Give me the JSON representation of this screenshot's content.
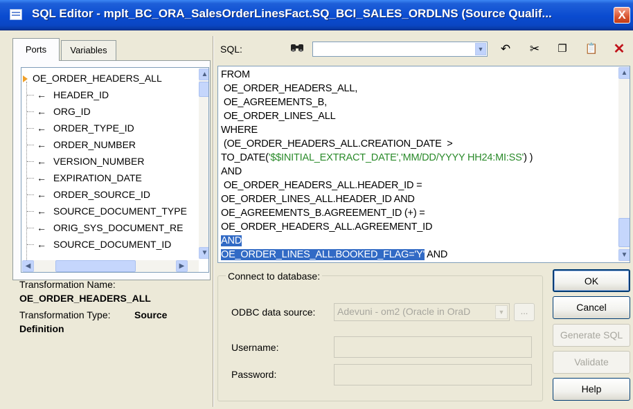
{
  "window": {
    "title": "SQL Editor - mplt_BC_ORA_SalesOrderLinesFact.SQ_BCI_SALES_ORDLNS (Source Qualif...",
    "close_label": "X"
  },
  "tabs": [
    {
      "label": "Ports"
    },
    {
      "label": "Variables"
    }
  ],
  "ports_tree": {
    "root": "OE_ORDER_HEADERS_ALL",
    "items": [
      "HEADER_ID",
      "ORG_ID",
      "ORDER_TYPE_ID",
      "ORDER_NUMBER",
      "VERSION_NUMBER",
      "EXPIRATION_DATE",
      "ORDER_SOURCE_ID",
      "SOURCE_DOCUMENT_TYPE",
      "ORIG_SYS_DOCUMENT_RE",
      "SOURCE_DOCUMENT_ID"
    ]
  },
  "transformation": {
    "name_label": "Transformation Name:",
    "name_value": "OE_ORDER_HEADERS_ALL",
    "type_label": "Transformation Type:",
    "type_value": "Source",
    "type_value_line2": "Definition"
  },
  "sql": {
    "label": "SQL:",
    "find_value": "",
    "lines": [
      "FROM",
      " OE_ORDER_HEADERS_ALL,",
      " OE_AGREEMENTS_B,",
      " OE_ORDER_LINES_ALL",
      "WHERE",
      " (OE_ORDER_HEADERS_ALL.CREATION_DATE  >",
      "TO_DATE(",
      "'$$INITIAL_EXTRACT_DATE','MM/DD/YYYY HH24:MI:SS'",
      ") )",
      "AND",
      " OE_ORDER_HEADERS_ALL.HEADER_ID =",
      "OE_ORDER_LINES_ALL.HEADER_ID AND",
      "OE_AGREEMENTS_B.AGREEMENT_ID (+) =",
      "OE_ORDER_HEADERS_ALL.AGREEMENT_ID",
      "AND",
      "OE_ORDER_LINES_ALL.BOOKED_FLAG='Y'",
      " AND"
    ]
  },
  "connect": {
    "legend": "Connect to database:",
    "odbc_label": "ODBC data source:",
    "odbc_value": "Adevuni - om2 (Oracle in OraD",
    "browse_label": "...",
    "username_label": "Username:",
    "username_value": "",
    "password_label": "Password:",
    "password_value": ""
  },
  "buttons": {
    "ok": "OK",
    "cancel": "Cancel",
    "generate_sql": "Generate SQL",
    "validate": "Validate",
    "help": "Help"
  }
}
